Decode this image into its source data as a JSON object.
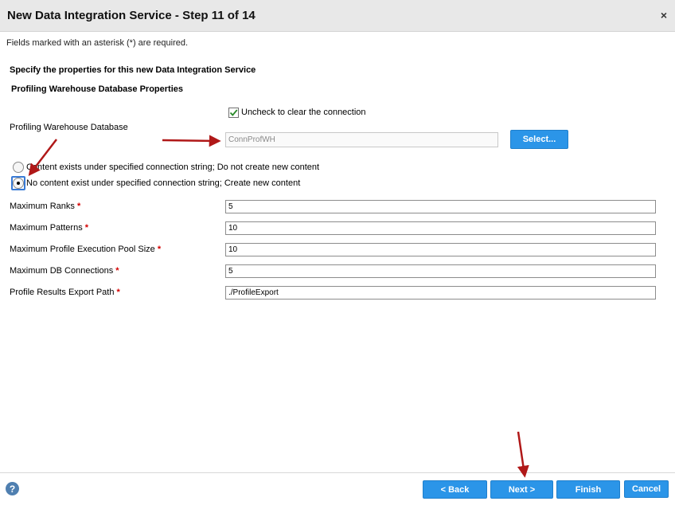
{
  "dialog": {
    "title": "New Data Integration Service - Step 11 of 14",
    "close_glyph": "×"
  },
  "required_note": "Fields marked with an asterisk (*) are required.",
  "section_heading": "Specify the properties for this new Data Integration Service",
  "subsection_heading": "Profiling Warehouse Database Properties",
  "connection": {
    "checkbox_label": "Uncheck to clear the connection",
    "checkbox_checked": true,
    "label": "Profiling Warehouse Database",
    "value": "ConnProfWH",
    "select_label": "Select..."
  },
  "content_options": [
    {
      "label": "Content exists under specified connection string; Do not create new content",
      "selected": false
    },
    {
      "label": "No content exist under specified connection string; Create new content",
      "selected": true
    }
  ],
  "fields": [
    {
      "label": "Maximum Ranks",
      "required_mark": "*",
      "value": "5"
    },
    {
      "label": "Maximum Patterns",
      "required_mark": "*",
      "value": "10"
    },
    {
      "label": "Maximum Profile Execution Pool Size",
      "required_mark": "*",
      "value": "10"
    },
    {
      "label": "Maximum DB Connections",
      "required_mark": "*",
      "value": "5"
    },
    {
      "label": "Profile Results Export Path",
      "required_mark": "*",
      "value": "./ProfileExport"
    }
  ],
  "footer": {
    "help_glyph": "?",
    "back_label": "< Back",
    "next_label": "Next >",
    "finish_label": "Finish",
    "cancel_label": "Cancel"
  },
  "colors": {
    "button_blue": "#2b95e8",
    "required_red": "#d40000",
    "annotation_arrow": "#b01818",
    "checkbox_tick": "#2a8a2a"
  },
  "icons": {
    "close": "close-icon",
    "help": "help-icon",
    "check": "checkmark-icon"
  }
}
